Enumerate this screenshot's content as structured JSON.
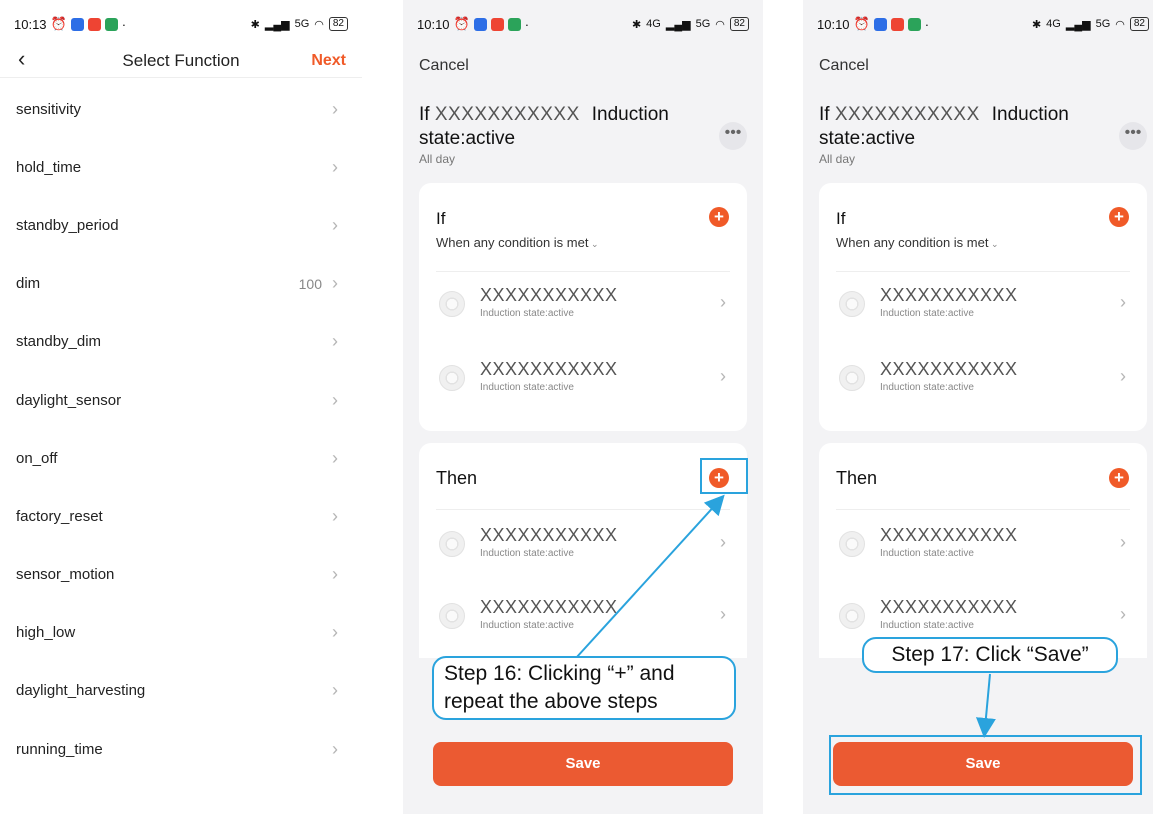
{
  "statusbar": {
    "screen1_time": "10:13",
    "screen2_time": "10:10",
    "screen3_time": "10:10",
    "battery": "82",
    "network_1": "4G",
    "network_2": "5G"
  },
  "screen1": {
    "title": "Select Function",
    "next_label": "Next",
    "back_icon": "chevron-left-icon",
    "functions": [
      {
        "label": "sensitivity",
        "value": ""
      },
      {
        "label": "hold_time",
        "value": ""
      },
      {
        "label": "standby_period",
        "value": ""
      },
      {
        "label": "dim",
        "value": "100"
      },
      {
        "label": "standby_dim",
        "value": ""
      },
      {
        "label": "daylight_sensor",
        "value": ""
      },
      {
        "label": "on_off",
        "value": ""
      },
      {
        "label": "factory_reset",
        "value": ""
      },
      {
        "label": "sensor_motion",
        "value": ""
      },
      {
        "label": "high_low",
        "value": ""
      },
      {
        "label": "daylight_harvesting",
        "value": ""
      },
      {
        "label": "running_time",
        "value": ""
      }
    ]
  },
  "scene": {
    "cancel_label": "Cancel",
    "title_prefix": "If",
    "title_device": "XXXXXXXXXXX",
    "title_line1_rest": "Induction",
    "title_line2": "state:active",
    "subtitle": "All day",
    "more_label": "•••",
    "if_section": {
      "heading": "If",
      "condition_mode": "When any condition is met",
      "items": [
        {
          "name": "XXXXXXXXXXX",
          "state": "Induction state:active"
        },
        {
          "name": "XXXXXXXXXXX",
          "state": "Induction state:active"
        }
      ]
    },
    "then_section": {
      "heading": "Then",
      "items": [
        {
          "name": "XXXXXXXXXXX",
          "state": "Induction state:active"
        },
        {
          "name": "XXXXXXXXXXX",
          "state": "Induction state:active"
        }
      ]
    },
    "save_label": "Save"
  },
  "annotations": {
    "step16_line1": "Step 16: Clicking “+” and",
    "step16_line2": "repeat the above steps",
    "step17": "Step 17: Click “Save”"
  },
  "colors": {
    "accent": "#f05a28",
    "annotation": "#2aa3dd",
    "background": "#f3f3f5"
  }
}
